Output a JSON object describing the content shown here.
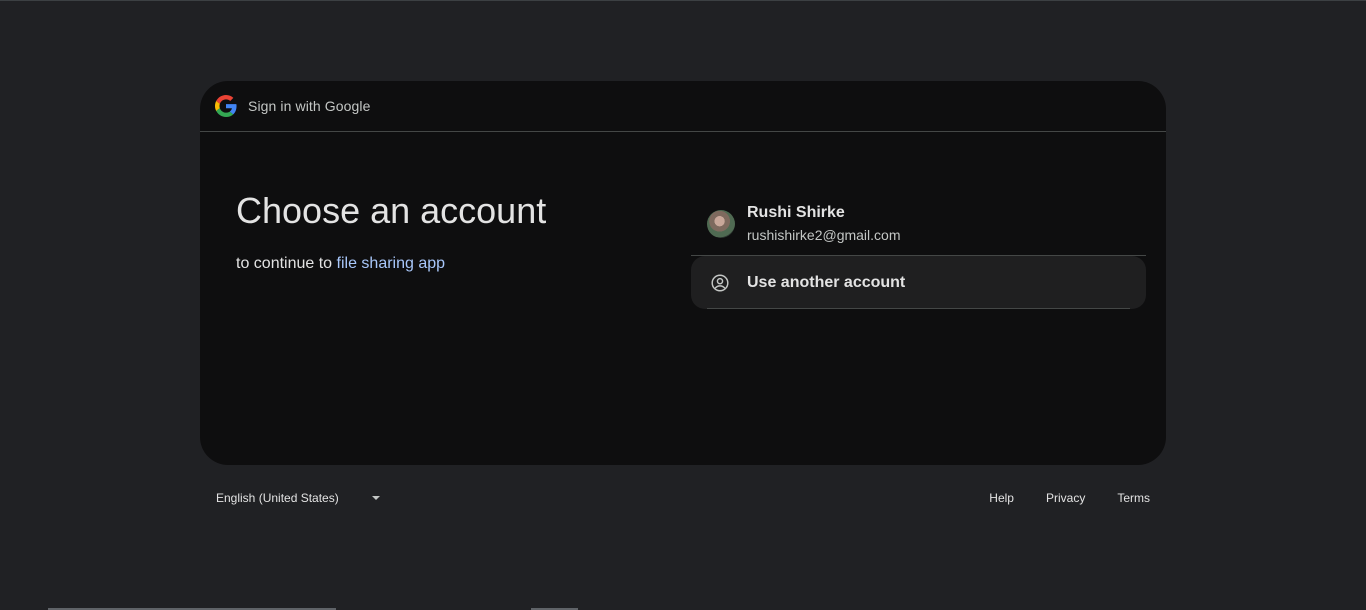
{
  "header": {
    "title": "Sign in with Google",
    "logo_icon": "google-g-icon"
  },
  "main": {
    "heading": "Choose an account",
    "subtitle_prefix": "to continue to",
    "app_name": "file sharing app"
  },
  "accounts": [
    {
      "name": "Rushi Shirke",
      "email": "rushishirke2@gmail.com"
    }
  ],
  "use_another": {
    "label": "Use another account",
    "icon": "account-circle-icon"
  },
  "footer": {
    "language": "English (United States)",
    "links": [
      "Help",
      "Privacy",
      "Terms"
    ]
  },
  "colors": {
    "page_bg": "#202124",
    "card_bg": "#0e0e0f",
    "link": "#a8c7fa",
    "text": "#e3e3e3"
  }
}
